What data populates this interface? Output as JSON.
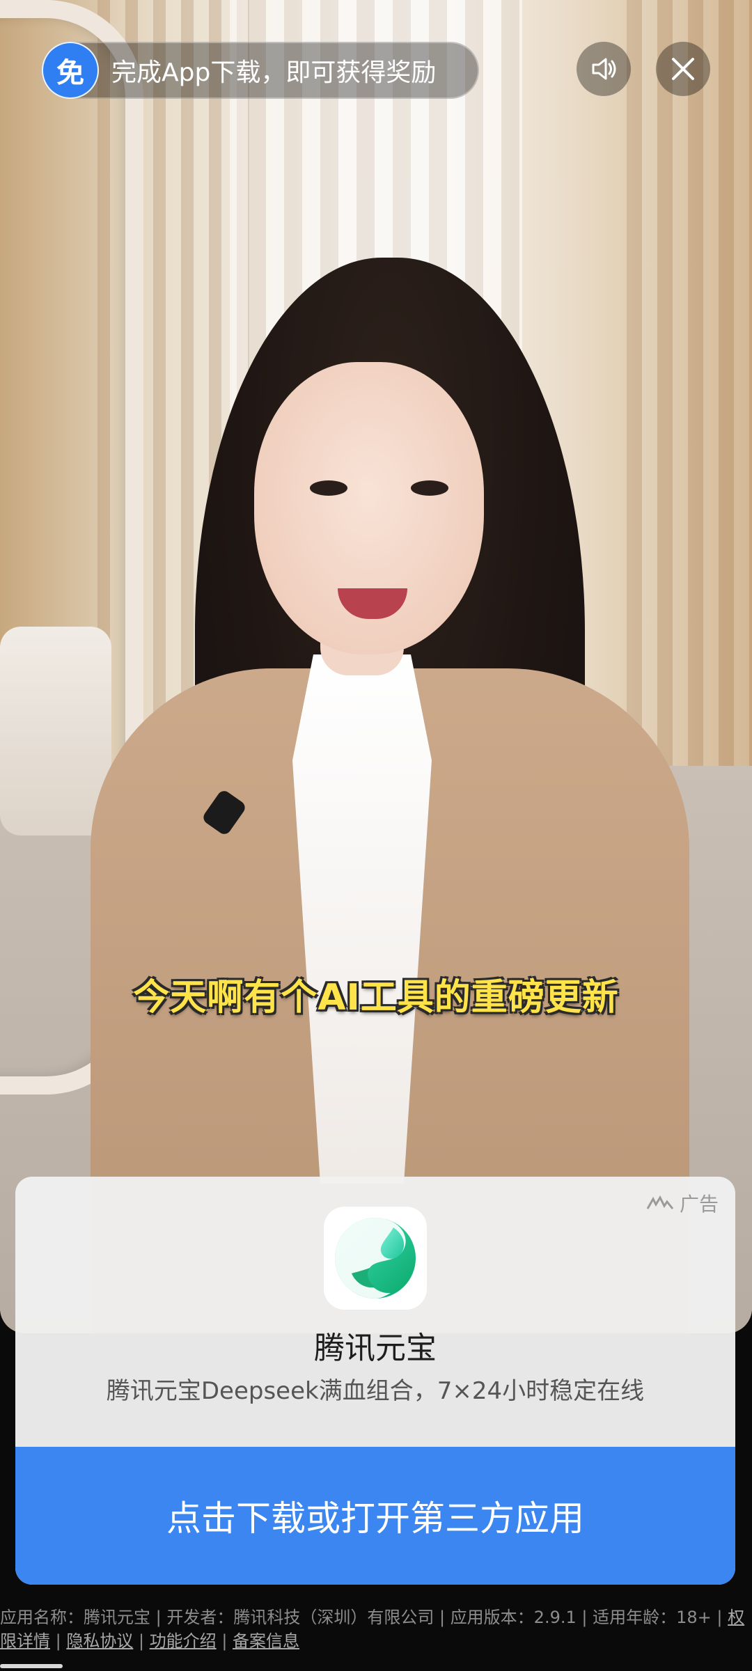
{
  "overlay": {
    "free_badge": "免",
    "reward_text": "完成App下载，即可获得奖励",
    "sound_icon": "speaker-icon",
    "close_icon": "close-icon"
  },
  "video": {
    "subtitle": "今天啊有个AI工具的重磅更新"
  },
  "ad": {
    "label": "广告",
    "app_name": "腾讯元宝",
    "description": "腾讯元宝Deepseek满血组合，7×24小时稳定在线",
    "cta": "点击下载或打开第三方应用",
    "accent_color": "#3b86f0"
  },
  "footer": {
    "app_name_label": "应用名称：腾讯元宝",
    "sep1": " | ",
    "developer": "开发者：腾讯科技（深圳）有限公司",
    "sep2": " | ",
    "version": "应用版本：2.9.1",
    "sep3": " | ",
    "age": "适用年龄：18+",
    "sep4": " | ",
    "permissions": "权限详情",
    "sep5": " | ",
    "privacy": "隐私协议",
    "sep6": " | ",
    "features": "功能介绍",
    "sep7": " | ",
    "filing": "备案信息"
  }
}
